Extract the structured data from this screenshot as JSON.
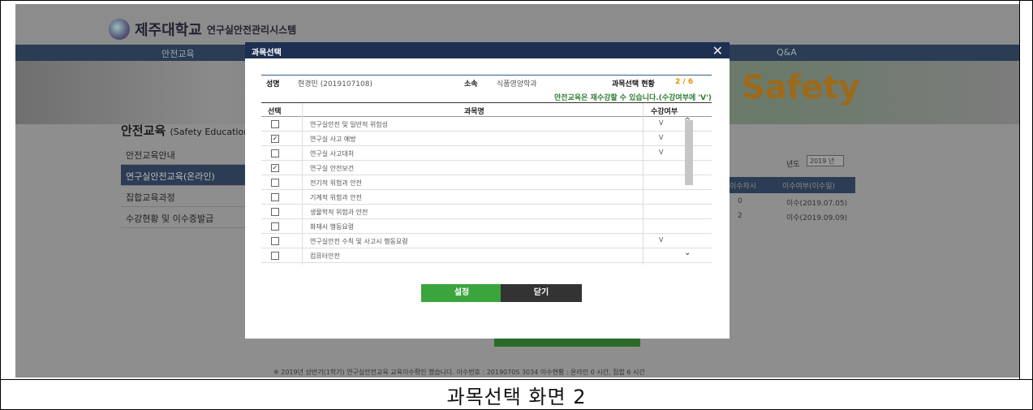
{
  "bg": {
    "logo_text": "제주대학교",
    "logo_sub": "연구실안전관리시스템",
    "nav": [
      "안전교육",
      "Q&A"
    ],
    "banner_word": "Safety",
    "side_title": "안전교육",
    "side_title_en": "(Safety Education)",
    "side_items": [
      "안전교육안내",
      "연구실안전교육(온라인)",
      "집합교육과정",
      "수강현황 및 이수증발급"
    ],
    "year_label": "년도",
    "year_value": "2019 년",
    "table_headers": [
      "이수차시",
      "이수여부(이수일)"
    ],
    "table_rows": [
      [
        "0",
        "이수(2019.07.05)"
      ],
      [
        "2",
        "이수(2019.09.09)"
      ]
    ],
    "footer_note": "※ 2019년 상반기(1학기) 연구실안전교육 교육이수확인 했습니다. 이수번호 : 2019070S 3034 이수현황 : 온라인 0 시간, 집합 6 시간"
  },
  "modal": {
    "title": "과목선택",
    "close_glyph": "✕",
    "info": {
      "name_label": "성명",
      "name_value": "현경민 (2019107108)",
      "dept_label": "소속",
      "dept_value": "식품영양학과",
      "status_label": "과목선택 현황",
      "status_value": "2 / 6"
    },
    "notice": "안전교육은 재수강할 수 있습니다.(수강여부에 'V')",
    "columns": [
      "선택",
      "과목명",
      "수강여부"
    ],
    "rows": [
      {
        "checked": "",
        "name": "연구실안전 및 일반적 위험성",
        "status": "V"
      },
      {
        "checked": "✓",
        "name": "연구실 사고 예방",
        "status": "V"
      },
      {
        "checked": "",
        "name": "연구실 사고대처",
        "status": "V"
      },
      {
        "checked": "✓",
        "name": "연구실 안전보건",
        "status": ""
      },
      {
        "checked": "",
        "name": "전기적 위험과 안전",
        "status": ""
      },
      {
        "checked": "",
        "name": "기계적 위험과 안전",
        "status": ""
      },
      {
        "checked": "",
        "name": "생물학적 위험과 안전",
        "status": ""
      },
      {
        "checked": "",
        "name": "화재시 행동요령",
        "status": ""
      },
      {
        "checked": "",
        "name": "연구실안전 수칙 및 사고시 행동요령",
        "status": "V"
      },
      {
        "checked": "",
        "name": "컴퓨터안전",
        "status": ""
      }
    ],
    "scroll_up": "^",
    "scroll_down": "⌄",
    "btn_set": "설정",
    "btn_close": "닫기"
  },
  "caption": "과목선택 화면 2"
}
